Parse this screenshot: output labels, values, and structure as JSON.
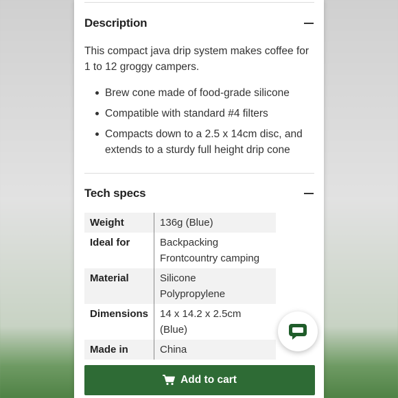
{
  "description": {
    "title": "Description",
    "paragraph_line1": "This compact java drip system makes coffee for",
    "paragraph_line2": "1 to 12 groggy campers.",
    "bullets": [
      {
        "line1": "Brew cone made of food-grade silicone",
        "line2": ""
      },
      {
        "line1": "Compatible with standard #4 filters",
        "line2": ""
      },
      {
        "line1": "Compacts down to a 2.5 x 14cm disc, and",
        "line2": "extends to a sturdy full height drip cone"
      }
    ]
  },
  "tech_specs": {
    "title": "Tech specs",
    "rows": [
      {
        "key": "Weight",
        "v1": "136g (Blue)",
        "v2": ""
      },
      {
        "key": "Ideal for",
        "v1": "Backpacking",
        "v2": "Frontcountry camping"
      },
      {
        "key": "Material",
        "v1": "Silicone",
        "v2": "Polypropylene"
      },
      {
        "key": "Dimensions",
        "v1": "14 x 14.2 x 2.5cm (Blue)",
        "v2": ""
      },
      {
        "key": "Made in",
        "v1": "China",
        "v2": ""
      }
    ]
  },
  "actions": {
    "add_to_cart": "Add to cart",
    "cart_icon": "shopping-cart-icon",
    "chat_icon": "chat-bubble-icon"
  },
  "colors": {
    "accent": "#2e6b35",
    "chat_icon": "#1f5c2a"
  }
}
